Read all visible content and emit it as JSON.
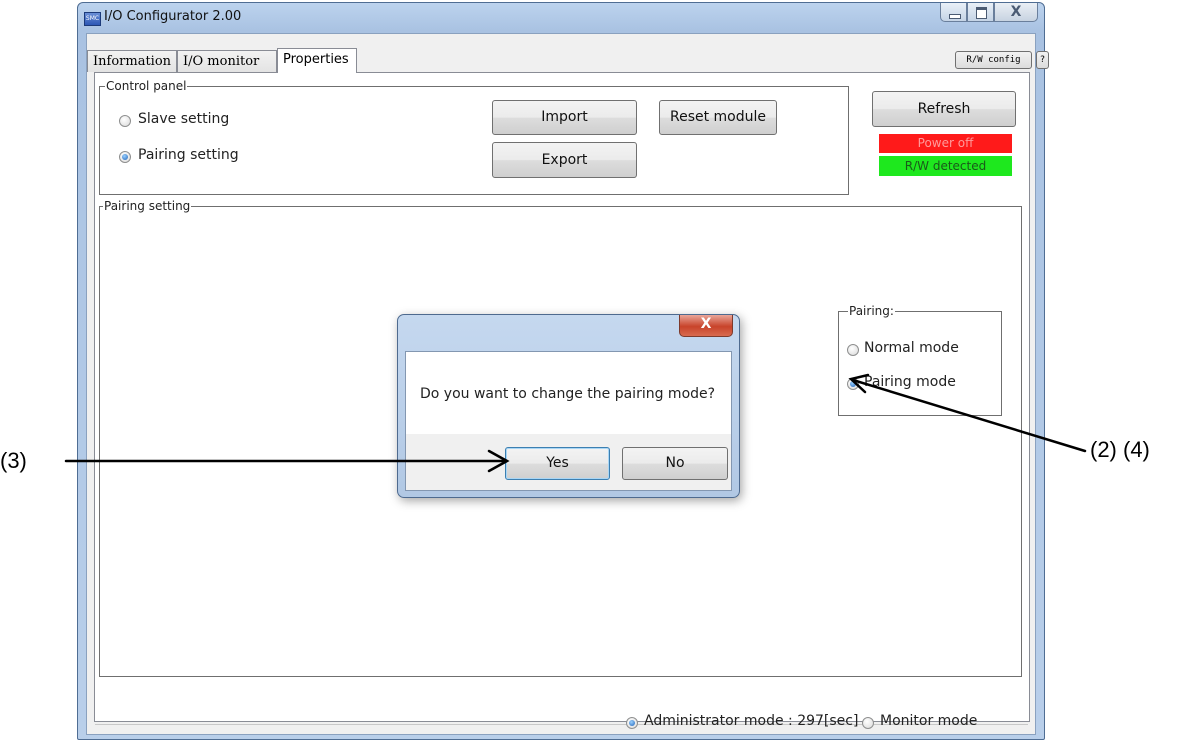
{
  "window": {
    "title": "I/O Configurator 2.00",
    "app_icon_text": "SMC",
    "caption_close": "X"
  },
  "tabs": [
    {
      "label": "Information",
      "active": false
    },
    {
      "label": "I/O monitor",
      "active": false
    },
    {
      "label": "Properties",
      "active": true
    }
  ],
  "toolbar": {
    "rw_config_label": "R/W config",
    "help_label": "?"
  },
  "control_panel": {
    "legend": "Control panel",
    "options": [
      {
        "label": "Slave setting",
        "selected": false
      },
      {
        "label": "Pairing setting",
        "selected": true
      }
    ],
    "import_label": "Import",
    "export_label": "Export",
    "reset_label": "Reset module"
  },
  "side": {
    "refresh_label": "Refresh",
    "power_status": "Power off",
    "power_color": "#ff1a1a",
    "power_text_color": "#ff9a9a",
    "rw_status": "R/W detected",
    "rw_color": "#1ee81e"
  },
  "pairing_setting": {
    "legend": "Pairing setting",
    "pairing_group": {
      "legend": "Pairing:",
      "options": [
        {
          "label": "Normal mode",
          "selected": false
        },
        {
          "label": "Pairing mode",
          "selected": true
        }
      ]
    }
  },
  "footer": {
    "admin_mode_label": "Administrator mode : 297[sec]",
    "admin_selected": true,
    "monitor_mode_label": "Monitor mode",
    "monitor_selected": false
  },
  "dialog": {
    "message": "Do you want to change the pairing mode?",
    "yes_label": "Yes",
    "no_label": "No",
    "close_label": "X"
  },
  "annotations": {
    "left_callout": "(3)",
    "right_callout": "(2) (4)"
  }
}
